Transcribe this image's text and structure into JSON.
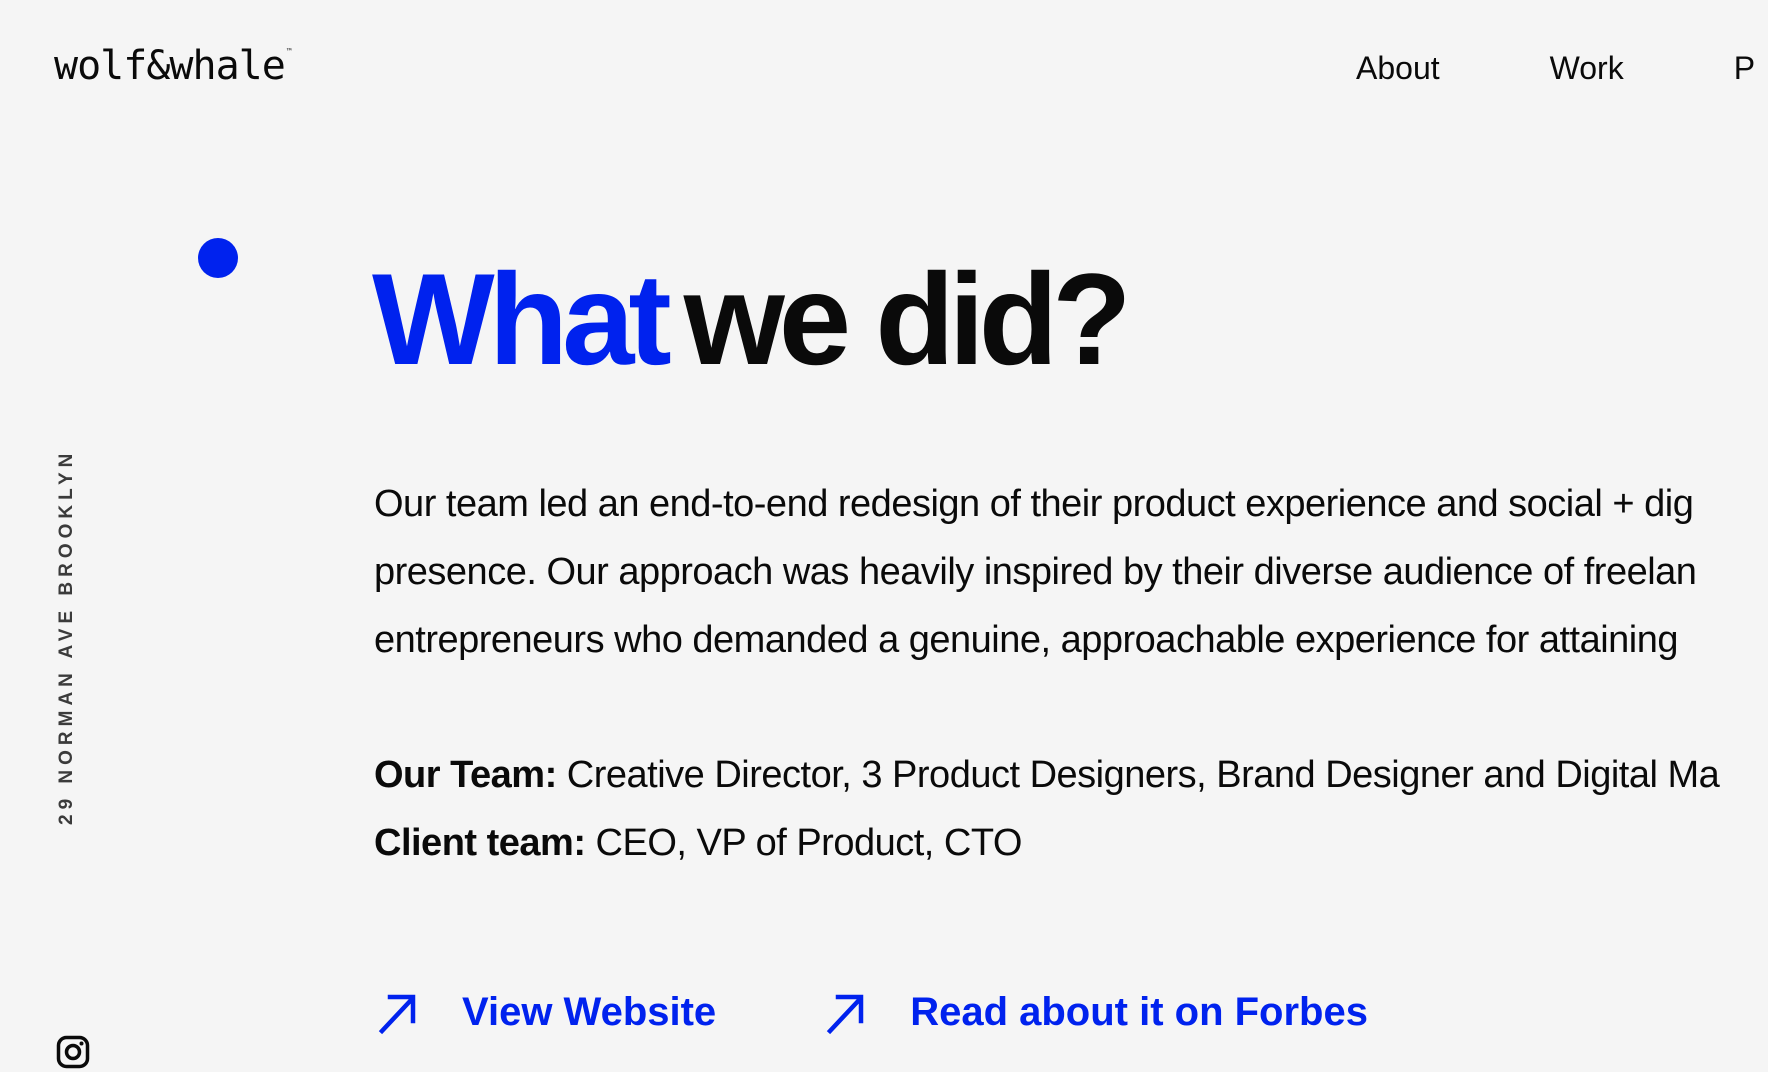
{
  "header": {
    "logo_text": "wolf&whale",
    "logo_mark": "™",
    "nav": [
      "About",
      "Work",
      "P"
    ]
  },
  "sidebar": {
    "address": "29 NORMAN AVE BROOKLYN",
    "social_icon": "instagram-icon"
  },
  "section": {
    "title_accent": "What",
    "title_rest": "we did?",
    "body_lines": [
      "Our team led an end-to-end redesign of their product experience and social + dig",
      "presence. Our approach was heavily inspired by their diverse audience of freelan",
      "entrepreneurs who demanded a genuine, approachable experience for attaining"
    ],
    "our_team_label": "Our Team:",
    "our_team_value": " Creative Director, 3 Product Designers, Brand Designer and Digital Ma",
    "client_team_label": "Client team:",
    "client_team_value": " CEO, VP of Product, CTO"
  },
  "links": [
    {
      "label": "View Website",
      "icon": "arrow-up-right-icon"
    },
    {
      "label": "Read about it on Forbes",
      "icon": "arrow-up-right-icon"
    }
  ],
  "colors": {
    "accent": "#0022ee",
    "background": "#f5f5f5",
    "text": "#0a0a0a"
  }
}
